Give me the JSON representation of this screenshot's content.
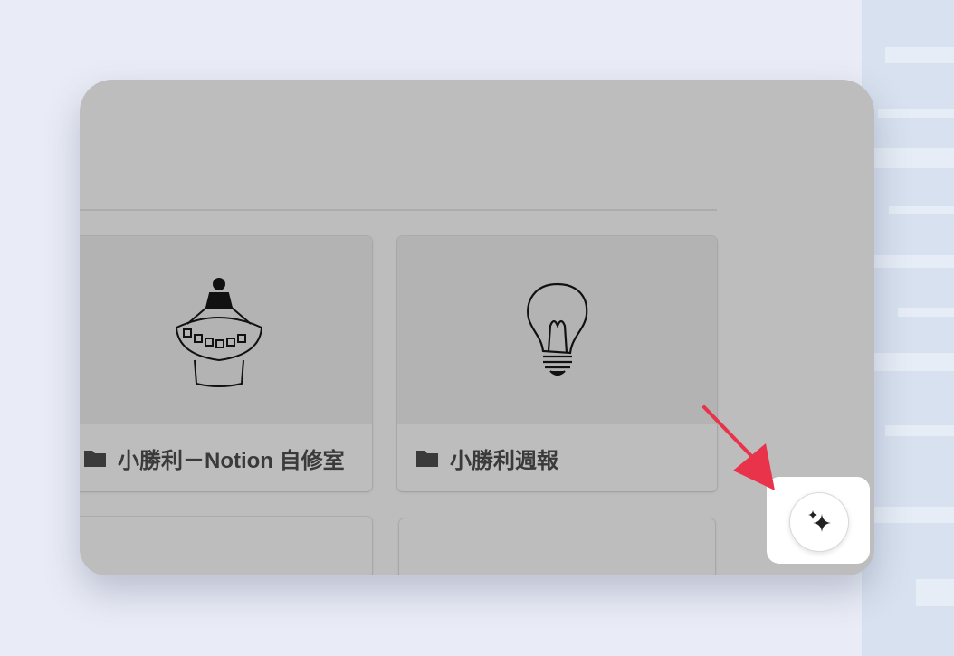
{
  "cards": [
    {
      "title": "小勝利－Notion 自修室",
      "icon": "folder-icon",
      "cover": "casino-dealer-illustration"
    },
    {
      "title": "小勝利週報",
      "icon": "folder-icon",
      "cover": "lightbulb-illustration"
    }
  ],
  "ai_button": {
    "icon": "sparkles-icon"
  },
  "colors": {
    "overlay": "#bdbdbd",
    "arrow": "#e8334a",
    "background": "#e9ecf6"
  }
}
